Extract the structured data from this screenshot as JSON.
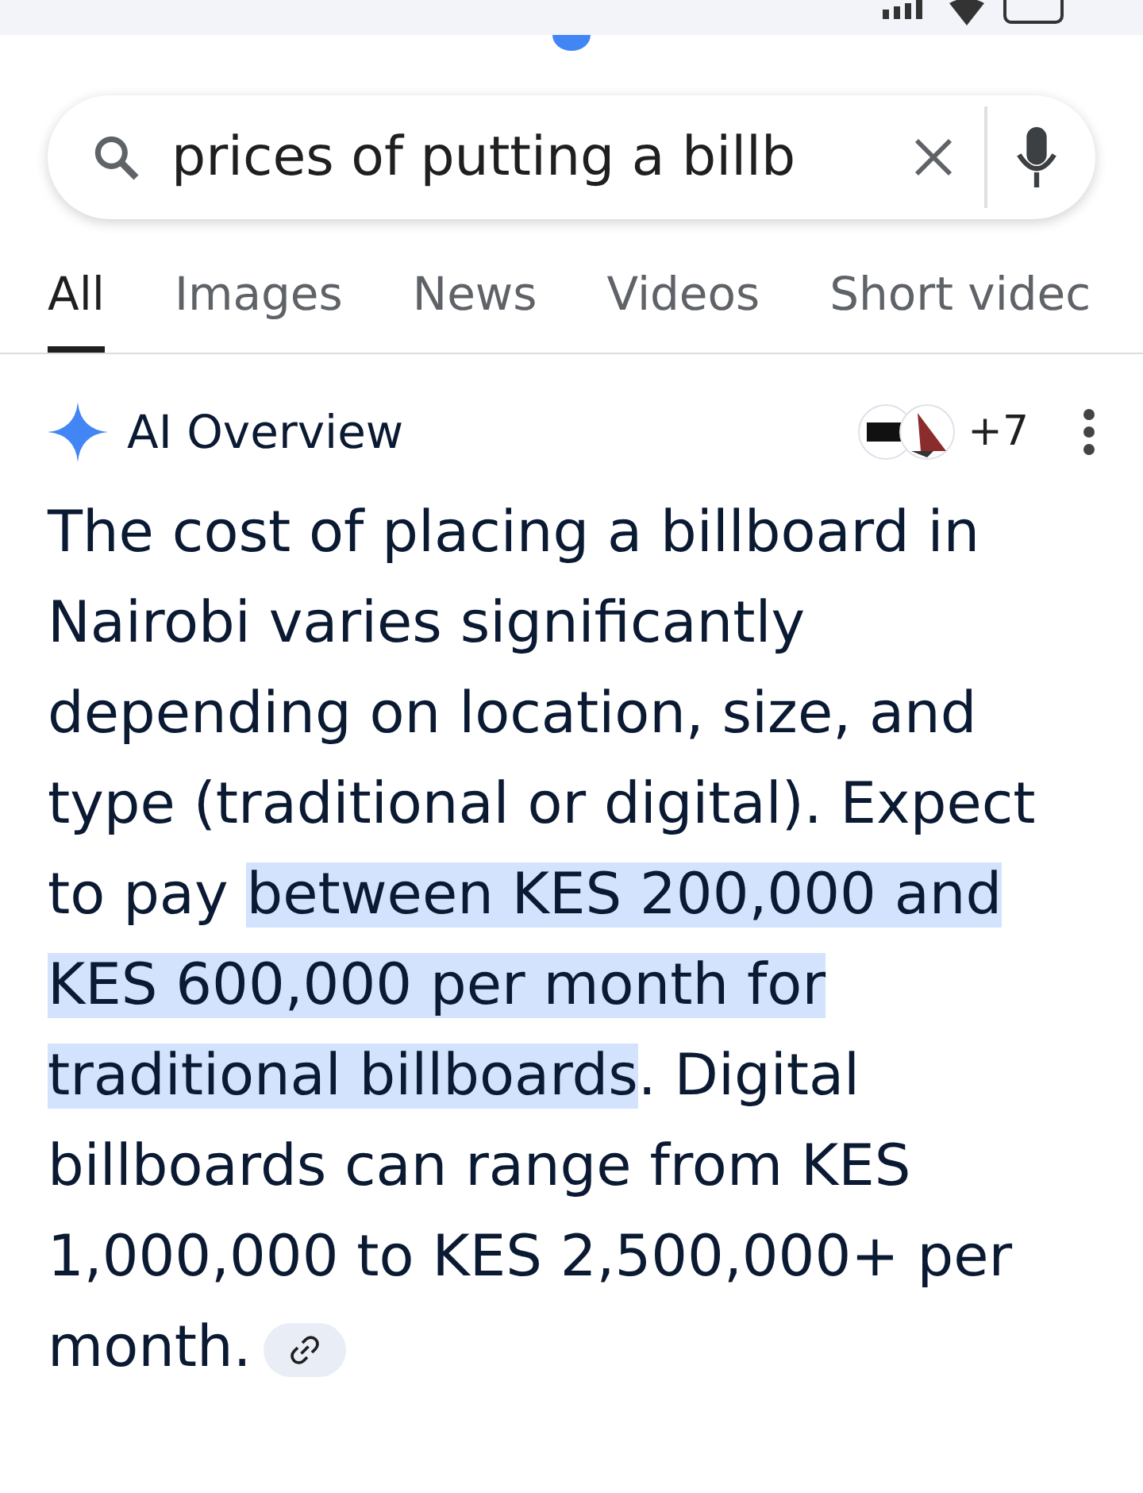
{
  "search": {
    "value": "prices of putting a billb"
  },
  "tabs": [
    {
      "label": "All",
      "selected": true
    },
    {
      "label": "Images",
      "selected": false
    },
    {
      "label": "News",
      "selected": false
    },
    {
      "label": "Videos",
      "selected": false
    },
    {
      "label": "Short videc",
      "selected": false
    }
  ],
  "ai_overview": {
    "title": "AI Overview",
    "sources_more": "+7",
    "before": "The cost of placing a billboard in Nairobi varies significantly depending on location, size, and type (traditional or digital). Expect to pay ",
    "highlight": "between KES 200,000 and KES 600,000 per month for traditional billboards",
    "after": ". Digital billboards can range from KES 1,000,000 to KES 2,500,000+ per month."
  }
}
